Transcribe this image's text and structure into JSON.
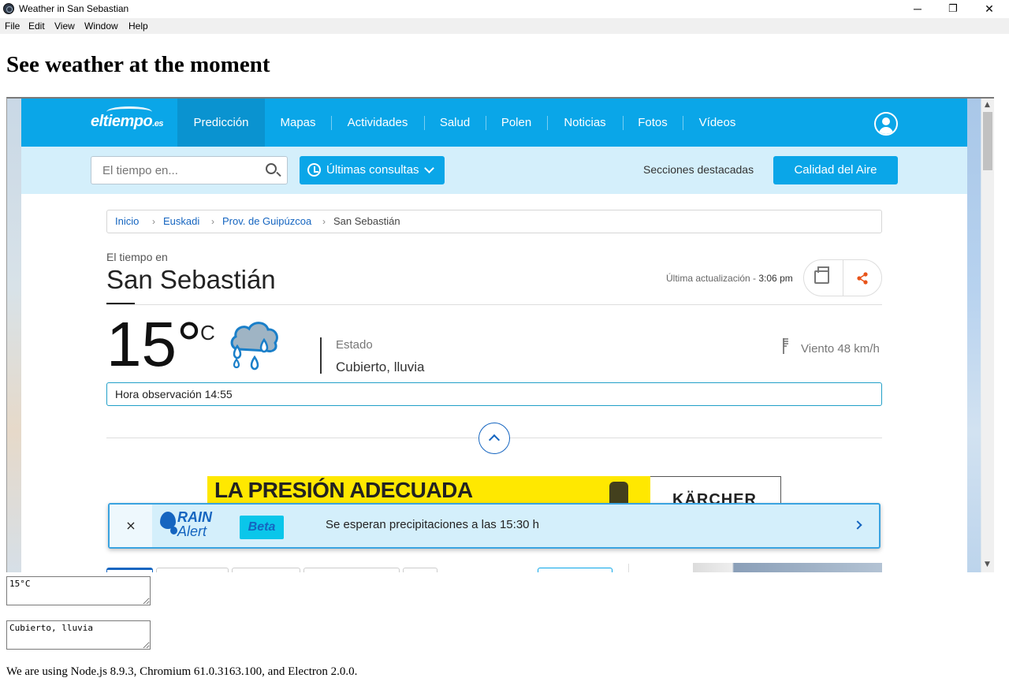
{
  "window": {
    "title": "Weather in San Sebastian",
    "controls": {
      "minimize": "─",
      "maximize": "❐",
      "close": "✕"
    }
  },
  "menu": [
    "File",
    "Edit",
    "View",
    "Window",
    "Help"
  ],
  "heading": "See weather at the moment",
  "site": {
    "logo": "eltiempo",
    "logo_suffix": ".es",
    "nav": [
      "Predicción",
      "Mapas",
      "Actividades",
      "Salud",
      "Polen",
      "Noticias",
      "Fotos",
      "Vídeos"
    ],
    "active_nav": "Predicción",
    "search": {
      "placeholder": "El tiempo en..."
    },
    "recent_button": "Últimas consultas",
    "featured_label": "Secciones destacadas",
    "air_button": "Calidad del Aire",
    "breadcrumb": [
      "Inicio",
      "Euskadi",
      "Prov. de Guipúzcoa",
      "San Sebastián"
    ],
    "weather_in_label": "El tiempo en",
    "city": "San Sebastián",
    "updated_label": "Última actualización - ",
    "updated_time": "3:06 pm",
    "temperature": "15°",
    "temperature_unit": "C",
    "estado_label": "Estado",
    "estado_value": "Cubierto, lluvia",
    "wind": "Viento 48 km/h",
    "observation": "Hora observación 14:55",
    "ad": {
      "headline": "LA PRESIÓN ADECUADA",
      "brand": "KÄRCHER"
    },
    "rain_alert": {
      "close": "×",
      "logo_line1": "RAIN",
      "logo_line2": "Alert",
      "badge": "Beta",
      "message": "Se esperan precipitaciones a las 15:30 h"
    }
  },
  "outputs": {
    "temperature_field": "15°C",
    "condition_field": "Cubierto, lluvia"
  },
  "footer": "We are using Node.js 8.9.3, Chromium 61.0.3163.100, and Electron 2.0.0.",
  "colors": {
    "brand_blue": "#0aa6e8",
    "accent_blue": "#1565c0",
    "light_blue": "#d4effb",
    "share_orange": "#e8541a"
  }
}
